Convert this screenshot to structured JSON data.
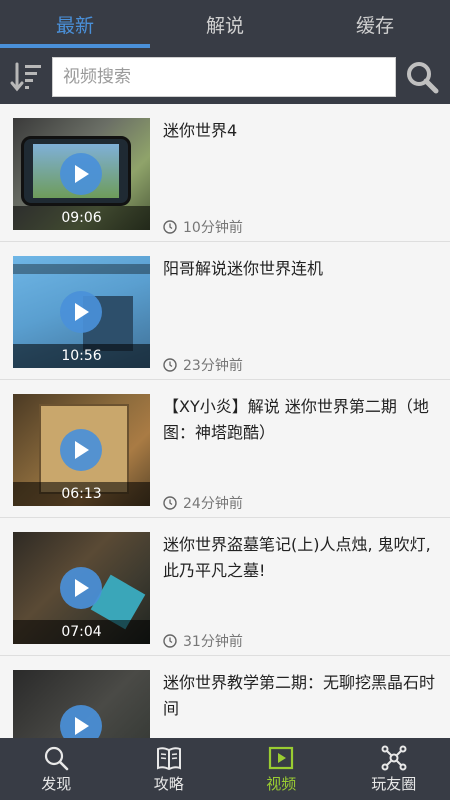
{
  "tabs": [
    {
      "label": "最新",
      "active": true
    },
    {
      "label": "解说",
      "active": false
    },
    {
      "label": "缓存",
      "active": false
    }
  ],
  "search": {
    "placeholder": "视频搜索"
  },
  "videos": [
    {
      "title": "迷你世界4",
      "duration": "09:06",
      "time": "10分钟前"
    },
    {
      "title": "阳哥解说迷你世界连机",
      "duration": "10:56",
      "time": "23分钟前"
    },
    {
      "title": "【XY小炎】解说 迷你世界第二期（地图：神塔跑酷）",
      "duration": "06:13",
      "time": "24分钟前"
    },
    {
      "title": "迷你世界盗墓笔记(上)人点烛, 鬼吹灯, 此乃平凡之墓!",
      "duration": "07:04",
      "time": "31分钟前"
    },
    {
      "title": "迷你世界教学第二期：无聊挖黑晶石时间",
      "duration": "",
      "time": ""
    }
  ],
  "bottom_nav": [
    {
      "label": "发现",
      "icon": "search-icon"
    },
    {
      "label": "攻略",
      "icon": "book-icon"
    },
    {
      "label": "视频",
      "icon": "video-icon",
      "active": true
    },
    {
      "label": "玩友圈",
      "icon": "network-icon"
    }
  ],
  "colors": {
    "accent": "#4a90d9",
    "nav_active": "#9acd32",
    "bar_bg": "#383c45"
  }
}
